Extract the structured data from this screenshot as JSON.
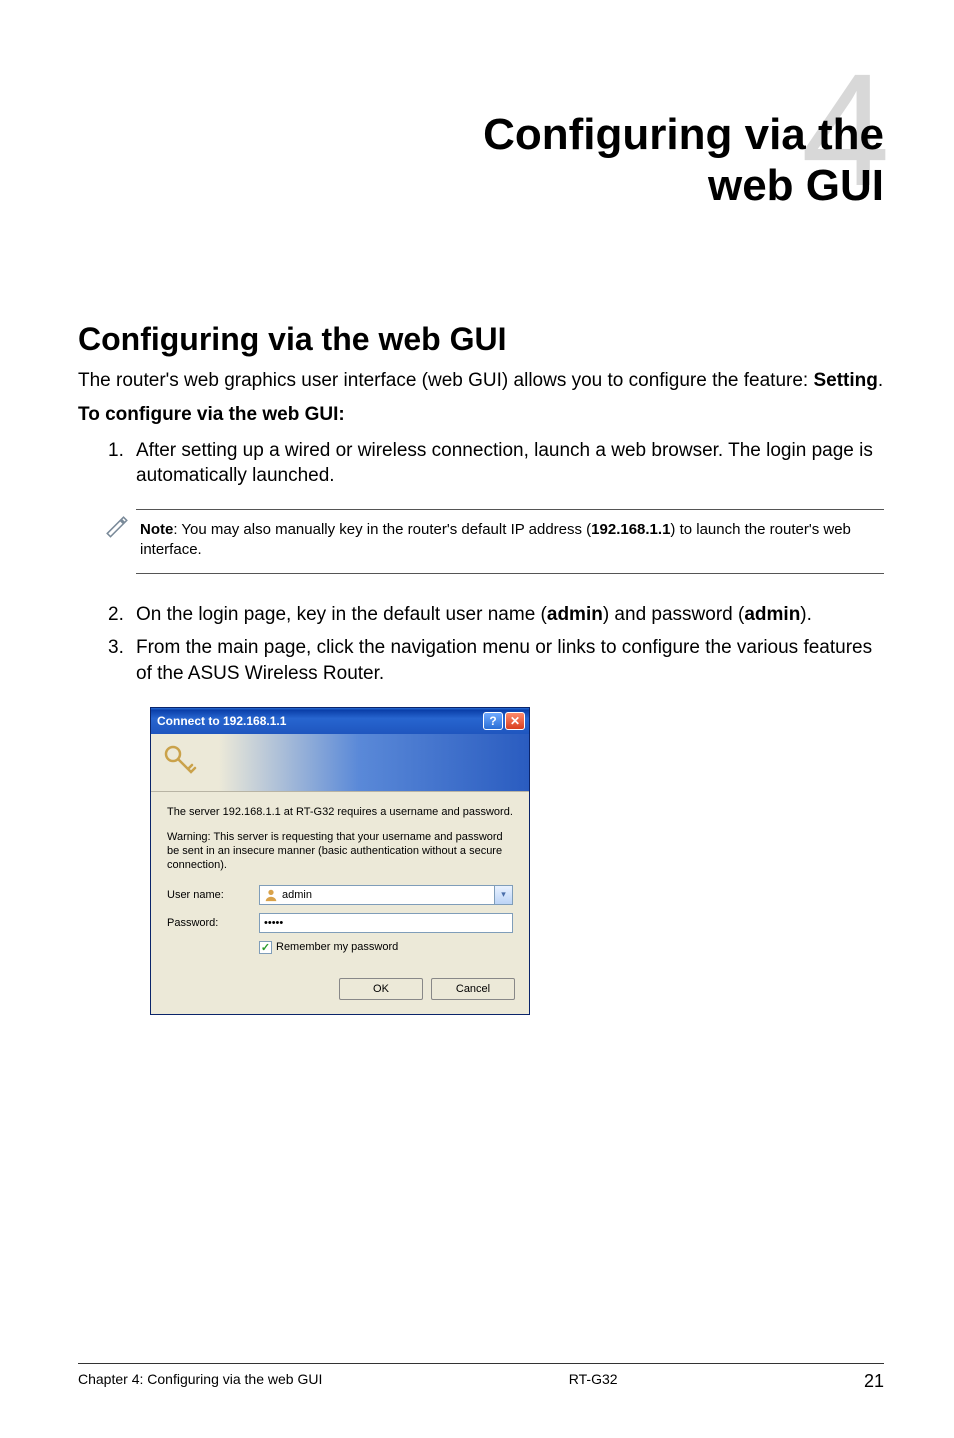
{
  "chapter": {
    "number": "4",
    "title_line1": "Configuring via the",
    "title_line2": "web GUI"
  },
  "section": {
    "heading": "Configuring via the web GUI",
    "intro_prefix": "The router's web graphics user interface (web GUI) allows you to configure the feature: ",
    "intro_bold": "Setting",
    "intro_suffix": ".",
    "subhead": "To configure via the web GUI:",
    "steps": [
      {
        "num": "1.",
        "text": "After setting up a wired or wireless connection, launch a web browser. The login page is automatically launched."
      }
    ],
    "note": {
      "label": "Note",
      "before_ip": ": You may also manually key in the router's default IP address (",
      "ip": "192.168.1.1",
      "after_ip": ") to launch the router's web interface."
    },
    "steps2": [
      {
        "num": "2.",
        "before": "On the login page, key in the default user name (",
        "b1": "admin",
        "mid": ") and password (",
        "b2": "admin",
        "after": ")."
      },
      {
        "num": "3.",
        "text": "From the main page, click the navigation menu or links to configure the various features of the ASUS Wireless Router."
      }
    ]
  },
  "dialog": {
    "title": "Connect to 192.168.1.1",
    "help_symbol": "?",
    "close_symbol": "✕",
    "p1": "The server 192.168.1.1 at RT-G32 requires a username and password.",
    "p2": "Warning: This server is requesting that your username and password be sent in an insecure manner (basic authentication without a secure connection).",
    "user_label": "User name:",
    "user_value": "admin",
    "pass_label": "Password:",
    "pass_value": "•••••",
    "remember": "Remember my password",
    "ok": "OK",
    "cancel": "Cancel",
    "checkmark": "✓",
    "chevron": "▾"
  },
  "footer": {
    "left": "Chapter 4: Configuring via the web GUI",
    "center": "RT-G32",
    "right": "21"
  }
}
